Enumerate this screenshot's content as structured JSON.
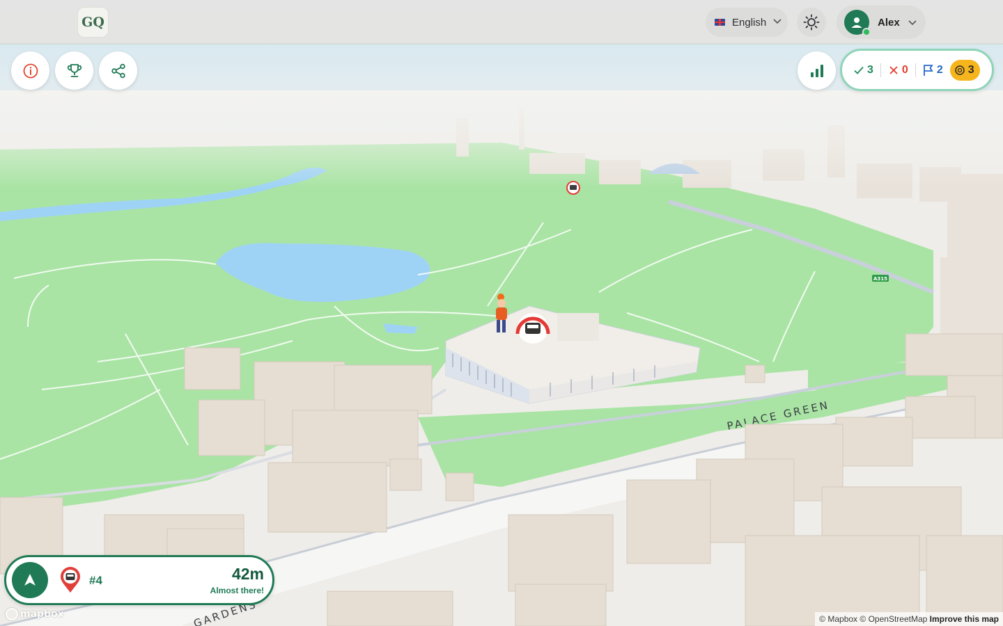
{
  "app": {
    "logo_text": "GQ"
  },
  "header": {
    "language": "English",
    "user_name": "Alex"
  },
  "scoreboard": {
    "correct": "3",
    "wrong": "0",
    "flags": "2",
    "coins": "3"
  },
  "map": {
    "road_labels": [
      "PALACE GREEN",
      "GARDENS"
    ],
    "road_shield": "A315",
    "attribution_mapbox": "© Mapbox",
    "attribution_osm": "© OpenStreetMap",
    "attribution_improve": "Improve this map",
    "logo": "mapbox"
  },
  "target": {
    "number": "#4",
    "distance": "42m",
    "status": "Almost there!"
  },
  "icons": {
    "info": "info-icon",
    "trophy": "trophy-icon",
    "share": "share-icon",
    "stats": "bar-chart-icon",
    "theme": "sun-icon",
    "navigate": "navigation-arrow-icon"
  },
  "colors": {
    "brand_green": "#1f7a55",
    "correct": "#1f8a5b",
    "wrong": "#e23d2d",
    "flag": "#2767c8",
    "coin": "#f6b51c",
    "park": "#a9e4a4",
    "water": "#9fd3f5",
    "target_ring": "#e53935"
  }
}
